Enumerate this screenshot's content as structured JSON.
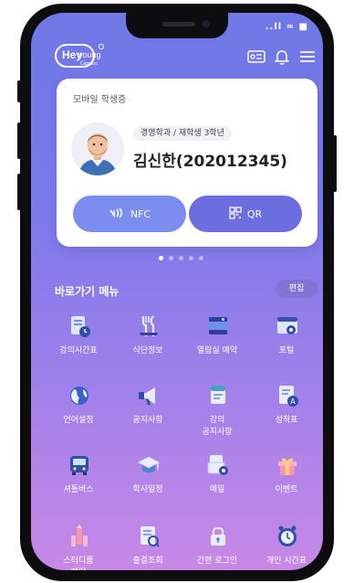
{
  "status_bar": {
    "indicators": "..ll ≈ ■"
  },
  "header": {
    "logo_main": "Hey",
    "logo_young": "young",
    "logo_sub": "Campus",
    "icons": [
      "id-card-icon",
      "bell-icon",
      "menu-icon"
    ]
  },
  "card": {
    "title": "모바일 학생증",
    "department": "경영학과 / 재학생 3학년",
    "name": "김신한(202012345)",
    "nfc_label": "NFC",
    "qr_label": "QR"
  },
  "pager": {
    "count": 5,
    "active": 0
  },
  "shortcuts": {
    "title": "바로가기 메뉴",
    "edit_label": "편집",
    "items": [
      {
        "label": "강의시간표",
        "icon": "timetable-icon"
      },
      {
        "label": "식단정보",
        "icon": "cutlery-icon"
      },
      {
        "label": "열람실 예약",
        "icon": "books-icon"
      },
      {
        "label": "포털",
        "icon": "portal-icon"
      },
      {
        "label": "언어설정",
        "icon": "globe-icon"
      },
      {
        "label": "공지사항",
        "icon": "megaphone-icon"
      },
      {
        "label": "강의\n공지사항",
        "icon": "notes-icon"
      },
      {
        "label": "성적표",
        "icon": "grades-icon"
      },
      {
        "label": "셔틀버스",
        "icon": "bus-icon"
      },
      {
        "label": "학사일정",
        "icon": "graduation-cap-icon"
      },
      {
        "label": "메일",
        "icon": "mail-icon"
      },
      {
        "label": "이벤트",
        "icon": "gift-icon"
      },
      {
        "label": "스터디룸\n예약",
        "icon": "pencil-icon"
      },
      {
        "label": "출결조회",
        "icon": "attendance-icon"
      },
      {
        "label": "간편 로그인",
        "icon": "lock-icon"
      },
      {
        "label": "개인 시간표",
        "icon": "clock-icon"
      }
    ]
  }
}
